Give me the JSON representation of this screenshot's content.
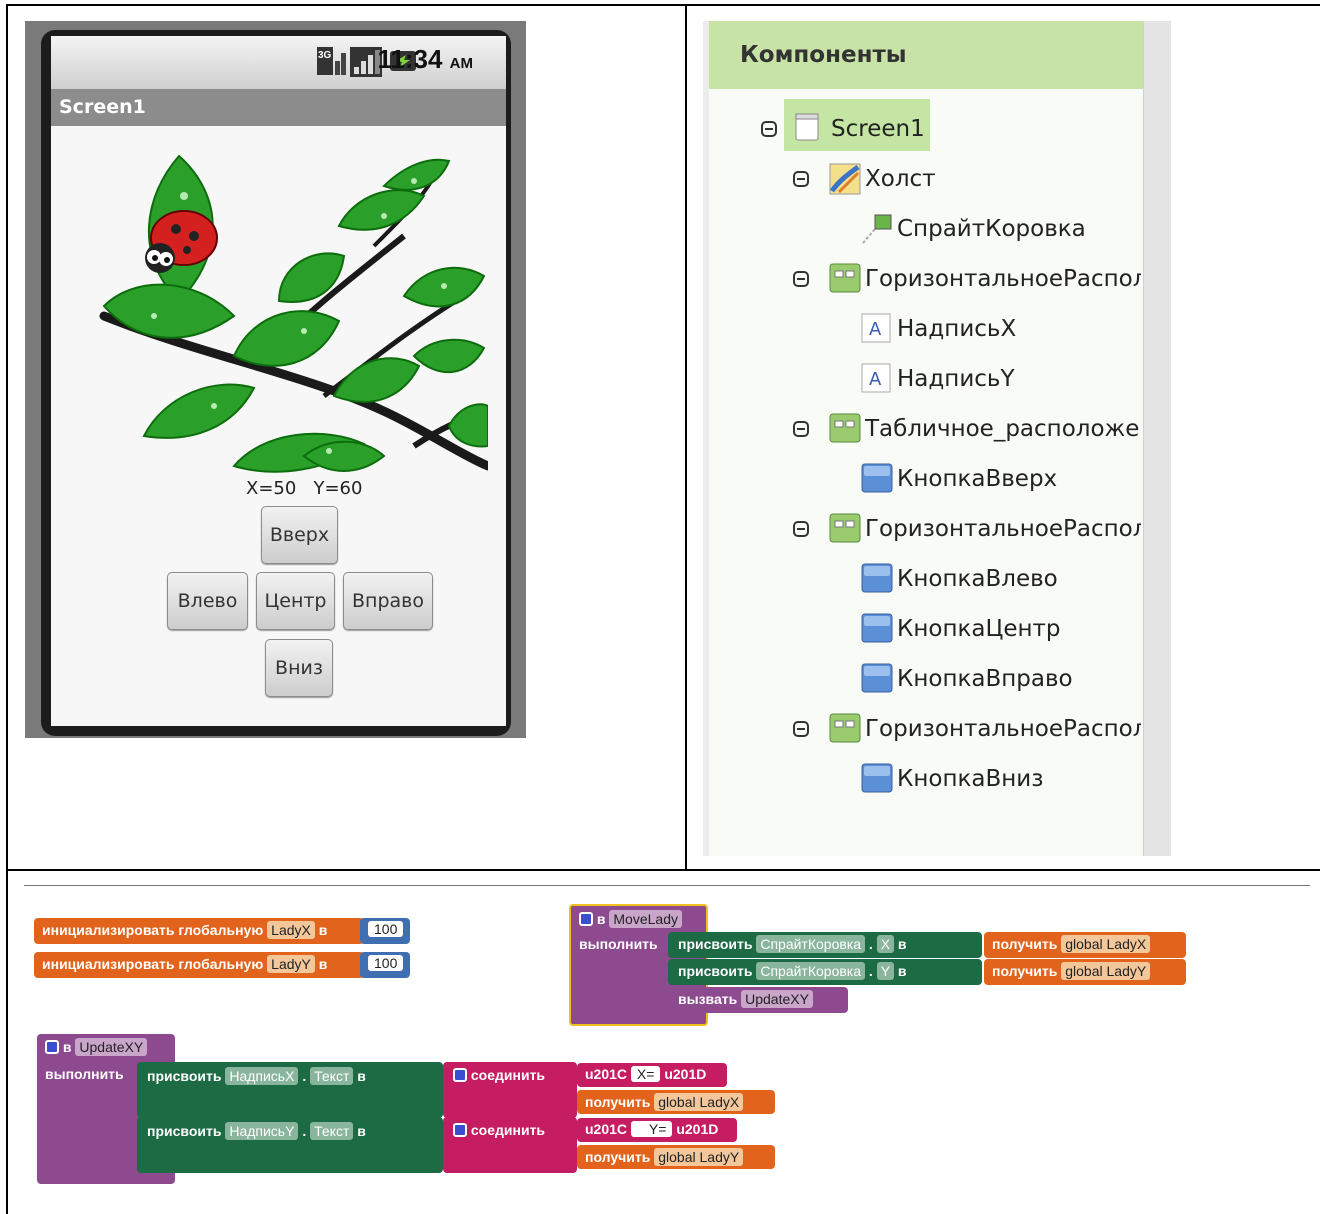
{
  "phone": {
    "status_time": "11:34",
    "status_ampm": "AM",
    "network_label": "3G",
    "title": "Screen1",
    "coords_label": "X=50   Y=60",
    "buttons": {
      "up": "Вверх",
      "left": "Влево",
      "center": "Центр",
      "right": "Вправо",
      "down": "Вниз"
    }
  },
  "components": {
    "header": "Компоненты",
    "tree": [
      {
        "label": "Screen1",
        "icon": "screen-icon"
      },
      {
        "label": "Холст",
        "icon": "canvas-icon"
      },
      {
        "label": "СпрайтКоровка",
        "icon": "sprite-icon"
      },
      {
        "label": "ГоризонтальноеРасполо",
        "icon": "arrangement-icon"
      },
      {
        "label": "НадписьX",
        "icon": "label-icon"
      },
      {
        "label": "НадписьY",
        "icon": "label-icon"
      },
      {
        "label": "Табличное_расположен",
        "icon": "arrangement-icon"
      },
      {
        "label": "КнопкаВверх",
        "icon": "button-icon"
      },
      {
        "label": "ГоризонтальноеРасполо",
        "icon": "arrangement-icon"
      },
      {
        "label": "КнопкаВлево",
        "icon": "button-icon"
      },
      {
        "label": "КнопкаЦентр",
        "icon": "button-icon"
      },
      {
        "label": "КнопкаВправо",
        "icon": "button-icon"
      },
      {
        "label": "ГоризонтальноеРасполо",
        "icon": "arrangement-icon"
      },
      {
        "label": "КнопкаВниз",
        "icon": "button-icon"
      }
    ]
  },
  "blocks": {
    "init_global": "инициализировать глобальную",
    "in": "в",
    "var_x": "LadyX",
    "var_y": "LadyY",
    "val_100": "100",
    "do": "выполнить",
    "set": "присвоить",
    "get": "получить",
    "call": "вызвать",
    "join": "соединить",
    "dot": ".",
    "proc_move": "MoveLady",
    "proc_update": "UpdateXY",
    "sprite": "СпрайтКоровка",
    "prop_x": "X",
    "prop_y": "Y",
    "label_x": "НадписьX",
    "label_y": "НадписьY",
    "prop_text": "Текст",
    "global_x": "global LadyX",
    "global_y": "global LadyY",
    "quote_open": "u201C",
    "quote_close": "u201D",
    "txt_x": "X=",
    "txt_y": "Y=",
    "colors": {
      "orange": "#e2641c",
      "purple": "#8e4a8f",
      "green": "#1c6b45",
      "magenta": "#c51c62",
      "blue": "#3f6fb0"
    }
  }
}
